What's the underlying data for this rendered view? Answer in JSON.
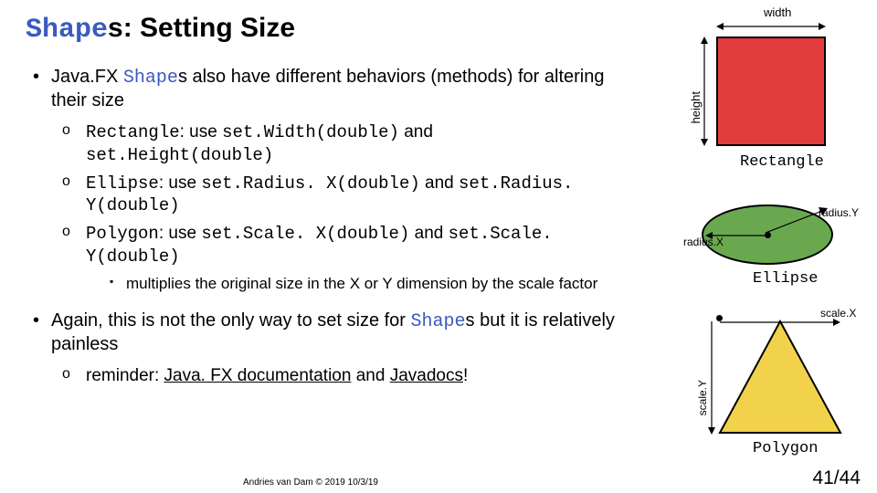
{
  "title": {
    "shape_word": "Shape",
    "suffix": "s: Setting Size"
  },
  "bullets": {
    "b1a_pre": "Java.FX ",
    "b1a_shape": "Shape",
    "b1a_post": "s also have different behaviors (methods) for altering their size",
    "b2_rect_pre": "",
    "b2_rect_kw": "Rectangle",
    "b2_rect_mid": ": use ",
    "b2_rect_m1": "set.Width(double)",
    "b2_rect_and": " and ",
    "b2_rect_m2": "set.Height(double)",
    "b2_ell_kw": "Ellipse",
    "b2_ell_mid": ": use ",
    "b2_ell_m1": "set.Radius. X(double)",
    "b2_ell_and": " and ",
    "b2_ell_m2": "set.Radius. Y(double)",
    "b2_poly_kw": "Polygon",
    "b2_poly_mid": ": use ",
    "b2_poly_m1": "set.Scale. X(double)",
    "b2_poly_and": " and ",
    "b2_poly_m2": "set.Scale. Y(double)",
    "b3_scale": "multiplies the original size in the X or Y dimension by the scale factor",
    "b1b_pre": "Again, this is not the only way to set size for ",
    "b1b_shape": "Shape",
    "b1b_post": "s but it is relatively painless",
    "b2_reminder_pre": "reminder: ",
    "b2_reminder_link1": "Java. FX documentation",
    "b2_reminder_mid": " and ",
    "b2_reminder_link2": "Javadocs",
    "b2_reminder_end": "!"
  },
  "labels": {
    "width": "width",
    "height": "height",
    "rectangle": "Rectangle",
    "radiusx": "radius.X",
    "radiusy": "radius.Y",
    "ellipse": "Ellipse",
    "scalex": "scale.X",
    "scaley": "scale.Y",
    "polygon": "Polygon"
  },
  "footer": "Andries van Dam © 2019 10/3/19",
  "page": "41/44"
}
